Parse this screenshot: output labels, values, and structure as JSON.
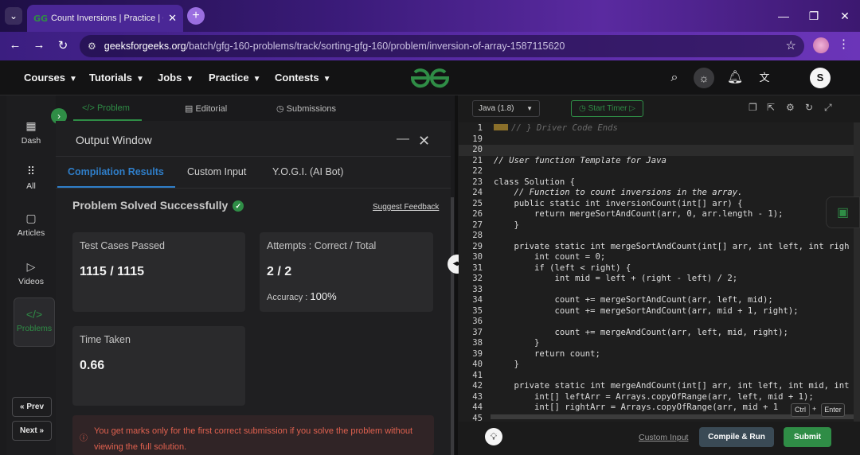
{
  "browser": {
    "tab_title": "Count Inversions | Practice | Ge",
    "url_host": "geeksforgeeks.org",
    "url_path": "/batch/gfg-160-problems/track/sorting-gfg-160/problem/inversion-of-array-1587115620"
  },
  "header": {
    "nav": [
      {
        "label": "Courses"
      },
      {
        "label": "Tutorials"
      },
      {
        "label": "Jobs"
      },
      {
        "label": "Practice"
      },
      {
        "label": "Contests"
      }
    ],
    "avatar_letter": "S"
  },
  "rail": {
    "items": [
      {
        "label": "Dash"
      },
      {
        "label": "All"
      },
      {
        "label": "Articles"
      },
      {
        "label": "Videos"
      },
      {
        "label": "Problems"
      }
    ],
    "prev_label": "« Prev",
    "next_label": "Next »"
  },
  "problem_tabs": [
    {
      "label": "Problem"
    },
    {
      "label": "Editorial"
    },
    {
      "label": "Submissions"
    }
  ],
  "output": {
    "title": "Output Window",
    "tabs": [
      {
        "label": "Compilation Results"
      },
      {
        "label": "Custom Input"
      },
      {
        "label": "Y.O.G.I. (AI Bot)"
      }
    ],
    "status": "Problem Solved Successfully",
    "feedback": "Suggest Feedback",
    "test_cases_label": "Test Cases Passed",
    "test_cases_value": "1115 / 1115",
    "attempts_label": "Attempts : Correct / Total",
    "attempts_value": "2 / 2",
    "accuracy_label": "Accuracy :",
    "accuracy_value": "100%",
    "time_label": "Time Taken",
    "time_value": "0.66",
    "notice": "You get marks only for the first correct submission if you solve the problem without viewing the full solution."
  },
  "editor": {
    "language": "Java (1.8)",
    "timer_label": "Start Timer",
    "lines": [
      {
        "n": "1",
        "t": "// } Driver Code Ends"
      },
      {
        "n": "19",
        "t": ""
      },
      {
        "n": "20",
        "t": ""
      },
      {
        "n": "21",
        "t": "// User function Template for Java"
      },
      {
        "n": "22",
        "t": ""
      },
      {
        "n": "23",
        "t": "class Solution {"
      },
      {
        "n": "24",
        "t": "    // Function to count inversions in the array."
      },
      {
        "n": "25",
        "t": "    public static int inversionCount(int[] arr) {"
      },
      {
        "n": "26",
        "t": "        return mergeSortAndCount(arr, 0, arr.length - 1);"
      },
      {
        "n": "27",
        "t": "    }"
      },
      {
        "n": "28",
        "t": ""
      },
      {
        "n": "29",
        "t": "    private static int mergeSortAndCount(int[] arr, int left, int righ"
      },
      {
        "n": "30",
        "t": "        int count = 0;"
      },
      {
        "n": "31",
        "t": "        if (left < right) {"
      },
      {
        "n": "32",
        "t": "            int mid = left + (right - left) / 2;"
      },
      {
        "n": "33",
        "t": ""
      },
      {
        "n": "34",
        "t": "            count += mergeSortAndCount(arr, left, mid);"
      },
      {
        "n": "35",
        "t": "            count += mergeSortAndCount(arr, mid + 1, right);"
      },
      {
        "n": "36",
        "t": ""
      },
      {
        "n": "37",
        "t": "            count += mergeAndCount(arr, left, mid, right);"
      },
      {
        "n": "38",
        "t": "        }"
      },
      {
        "n": "39",
        "t": "        return count;"
      },
      {
        "n": "40",
        "t": "    }"
      },
      {
        "n": "41",
        "t": ""
      },
      {
        "n": "42",
        "t": "    private static int mergeAndCount(int[] arr, int left, int mid, int"
      },
      {
        "n": "43",
        "t": "        int[] leftArr = Arrays.copyOfRange(arr, left, mid + 1);"
      },
      {
        "n": "44",
        "t": "        int[] rightArr = Arrays.copyOfRange(arr, mid + 1"
      },
      {
        "n": "45",
        "t": ""
      }
    ],
    "kbd_ctrl": "Ctrl",
    "kbd_enter": "Enter",
    "custom_input": "Custom Input",
    "compile_run": "Compile & Run",
    "submit": "Submit"
  }
}
